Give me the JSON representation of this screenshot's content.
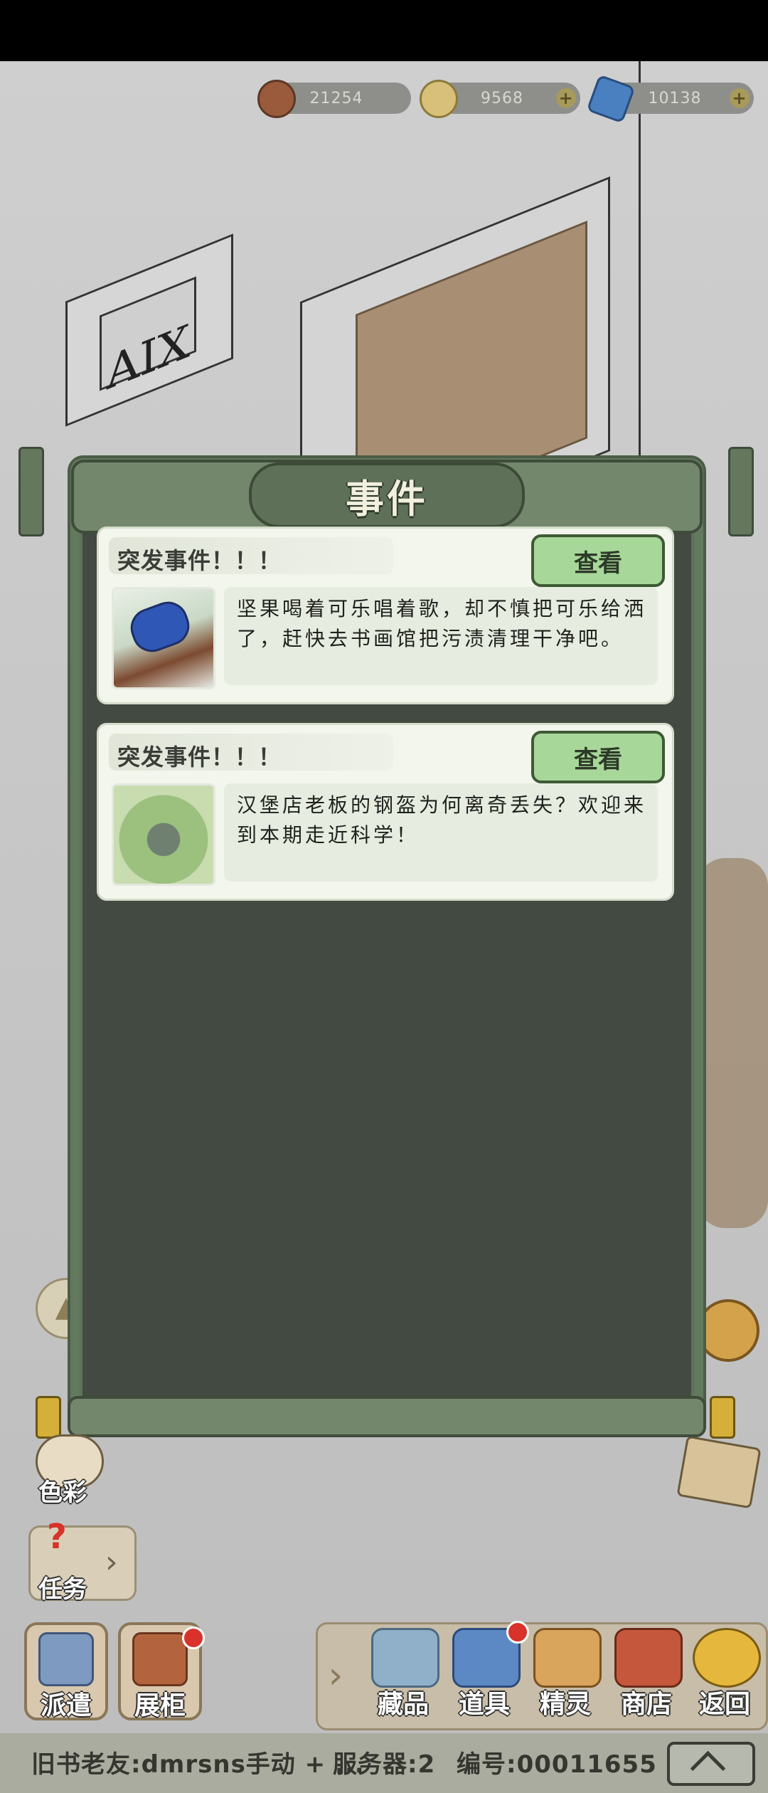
{
  "resources": [
    {
      "name": "gear-coin",
      "value": "21254",
      "has_plus": false
    },
    {
      "name": "flower",
      "value": "9568",
      "has_plus": true
    },
    {
      "name": "crystal",
      "value": "10138",
      "has_plus": true
    }
  ],
  "scene_sign": "AIX",
  "panel": {
    "title": "事件",
    "cards": [
      {
        "tag": "突发事件！！！",
        "button": "查看",
        "description": "坚果喝着可乐唱着歌，却不慎把可乐给洒了，赶快去书画馆把污渍清理干净吧。"
      },
      {
        "tag": "突发事件！！！",
        "button": "查看",
        "description": "汉堡店老板的钢盔为何离奇丢失？欢迎来到本期走近科学！"
      }
    ]
  },
  "side": {
    "color_label": "色彩",
    "task_label": "任务"
  },
  "dock_left": [
    {
      "label": "派遣"
    },
    {
      "label": "展柜"
    }
  ],
  "dock": [
    {
      "label": "藏品"
    },
    {
      "label": "道具"
    },
    {
      "label": "精灵"
    },
    {
      "label": "商店"
    },
    {
      "label": "返回"
    }
  ],
  "footer": {
    "friend": "旧书老友:dmrsns手动 + ...",
    "server": "服务器:2",
    "id": "编号:00011655"
  },
  "colors": {
    "panel_frame": "#63795d",
    "panel_inner": "#434a42",
    "card_bg": "#f3f6ec",
    "button_green": "#a8d79a"
  }
}
